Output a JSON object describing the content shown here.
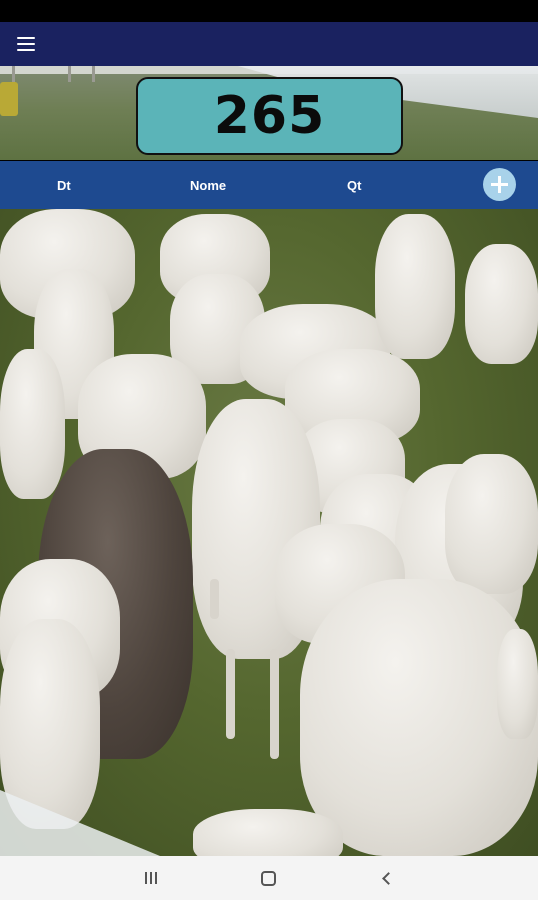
{
  "app": {
    "menu_icon": "hamburger-menu-icon"
  },
  "counter": {
    "value": "265",
    "background": "#5bb4b8"
  },
  "table": {
    "columns": [
      "Dt",
      "Nome",
      "Qt"
    ],
    "header_background": "#1e4a90",
    "add_icon": "plus-icon"
  },
  "colors": {
    "app_bar": "#1a2260",
    "add_button": "#a8d2ea"
  },
  "nav": {
    "recents_icon": "recents-icon",
    "home_icon": "home-icon",
    "back_icon": "back-icon"
  }
}
